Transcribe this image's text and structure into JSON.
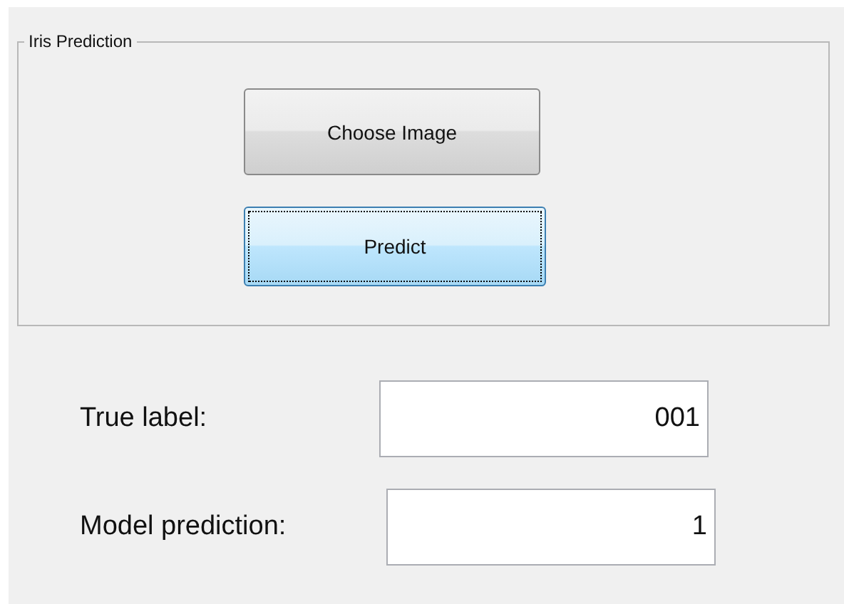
{
  "panel": {
    "title": "Iris Prediction",
    "buttons": [
      {
        "label": "Choose Image",
        "focused": false
      },
      {
        "label": "Predict",
        "focused": true
      }
    ]
  },
  "fields": [
    {
      "label": "True label:",
      "value": "001"
    },
    {
      "label": "Model prediction:",
      "value": "1"
    }
  ]
}
